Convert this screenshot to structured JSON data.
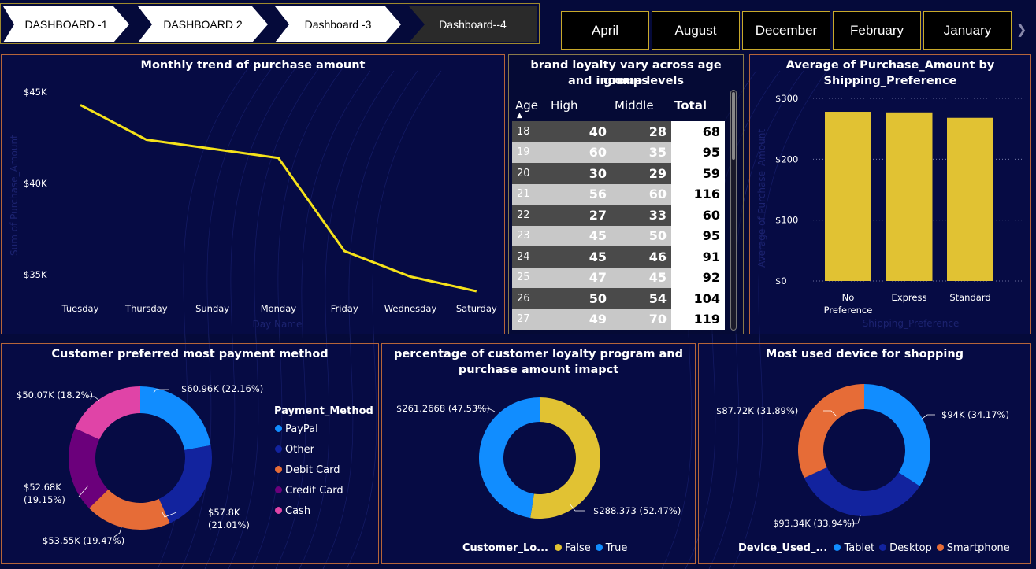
{
  "nav": {
    "tabs": [
      "DASHBOARD -1",
      "DASHBOARD 2",
      "Dashboard -3",
      "Dashboard--4"
    ]
  },
  "months": [
    "April",
    "August",
    "December",
    "February",
    "January"
  ],
  "colors": {
    "accent_yellow": "#f5e21a",
    "bar_yellow": "#e1c233",
    "paypal": "#118dff",
    "other": "#12239e",
    "debit_card": "#e66c37",
    "credit_card": "#6b007b",
    "cash": "#e044a7",
    "false": "#e1c233",
    "true": "#118dff"
  },
  "trend": {
    "title": "Monthly trend of purchase amount",
    "xlabel": "Day Name",
    "ylabel": "Sum of Purchase_Amount",
    "yticks": [
      "$45K",
      "$40K",
      "$35K"
    ]
  },
  "loyalty_table": {
    "title_line1": "brand loyalty vary across age groups",
    "title_line2": "and income levels",
    "headers": [
      "Age",
      "High",
      "Middle",
      "Total"
    ],
    "sort_icon": "sort-up-icon",
    "rows": [
      [
        "18",
        "40",
        "28",
        "68"
      ],
      [
        "19",
        "60",
        "35",
        "95"
      ],
      [
        "20",
        "30",
        "29",
        "59"
      ],
      [
        "21",
        "56",
        "60",
        "116"
      ],
      [
        "22",
        "27",
        "33",
        "60"
      ],
      [
        "23",
        "45",
        "50",
        "95"
      ],
      [
        "24",
        "45",
        "46",
        "91"
      ],
      [
        "25",
        "47",
        "45",
        "92"
      ],
      [
        "26",
        "50",
        "54",
        "104"
      ],
      [
        "27",
        "49",
        "70",
        "119"
      ]
    ]
  },
  "shipping": {
    "title_line1": "Average of Purchase_Amount by",
    "title_line2": "Shipping_Preference",
    "xlabel": "Shipping_Preference",
    "ylabel": "Average of Purchase_Amount",
    "yticks": [
      "$300",
      "$200",
      "$100",
      "$0"
    ],
    "category_lines": [
      [
        "No",
        "Preference"
      ],
      [
        "Express"
      ],
      [
        "Standard"
      ]
    ]
  },
  "payment": {
    "title": "Customer preferred most payment method",
    "legend_title": "Payment_Method",
    "labels": [
      "$60.96K (22.16%)",
      "$57.8K",
      "(21.01%)",
      "$53.55K (19.47%)",
      "$52.68K",
      "(19.15%)",
      "$50.07K (18.2%)"
    ]
  },
  "loyalty_program": {
    "title_line1": "percentage of customer loyalty program and",
    "title_line2": "purchase amount imapct",
    "legend_title": "Customer_Lo...",
    "labels": [
      "$261.2668 (47.53%)",
      "$288.373 (52.47%)"
    ]
  },
  "device": {
    "title": "Most used device for shopping",
    "legend_title": "Device_Used_...",
    "labels": [
      "$94K (34.17%)",
      "$93.34K (33.94%)",
      "$87.72K (31.89%)"
    ]
  },
  "chart_data": [
    {
      "type": "line",
      "title": "Monthly trend of purchase amount",
      "xlabel": "Day Name",
      "ylabel": "Sum of Purchase_Amount",
      "x": [
        "Tuesday",
        "Thursday",
        "Sunday",
        "Monday",
        "Friday",
        "Wednesday",
        "Saturday"
      ],
      "values": [
        44300,
        42400,
        41900,
        41400,
        36300,
        34900,
        34100
      ],
      "ylim": [
        33500,
        46000
      ],
      "color": "#f5e21a"
    },
    {
      "type": "table",
      "title": "brand loyalty vary across age groups and income levels",
      "columns": [
        "Age",
        "High",
        "Middle",
        "Total"
      ],
      "rows": [
        [
          18,
          40,
          28,
          68
        ],
        [
          19,
          60,
          35,
          95
        ],
        [
          20,
          30,
          29,
          59
        ],
        [
          21,
          56,
          60,
          116
        ],
        [
          22,
          27,
          33,
          60
        ],
        [
          23,
          45,
          50,
          95
        ],
        [
          24,
          45,
          46,
          91
        ],
        [
          25,
          47,
          45,
          92
        ],
        [
          26,
          50,
          54,
          104
        ],
        [
          27,
          49,
          70,
          119
        ]
      ]
    },
    {
      "type": "bar",
      "title": "Average of Purchase_Amount by Shipping_Preference",
      "xlabel": "Shipping_Preference",
      "ylabel": "Average of Purchase_Amount",
      "categories": [
        "No Preference",
        "Express",
        "Standard"
      ],
      "values": [
        278,
        277,
        268
      ],
      "ylim": [
        0,
        300
      ]
    },
    {
      "type": "pie",
      "title": "Customer preferred most payment method",
      "legend_title": "Payment_Method",
      "categories": [
        "PayPal",
        "Other",
        "Debit Card",
        "Credit Card",
        "Cash"
      ],
      "values": [
        60960,
        57800,
        53550,
        52680,
        50070
      ],
      "percentages": [
        22.16,
        21.01,
        19.47,
        19.15,
        18.2
      ]
    },
    {
      "type": "pie",
      "title": "percentage of customer loyalty program and purchase amount imapct",
      "legend_title": "Customer_Lo...",
      "categories": [
        "False",
        "True"
      ],
      "values": [
        288.373,
        261.2668
      ],
      "percentages": [
        52.47,
        47.53
      ]
    },
    {
      "type": "pie",
      "title": "Most used device for shopping",
      "legend_title": "Device_Used_...",
      "categories": [
        "Tablet",
        "Desktop",
        "Smartphone"
      ],
      "values": [
        94000,
        93340,
        87720
      ],
      "percentages": [
        34.17,
        33.94,
        31.89
      ]
    }
  ]
}
